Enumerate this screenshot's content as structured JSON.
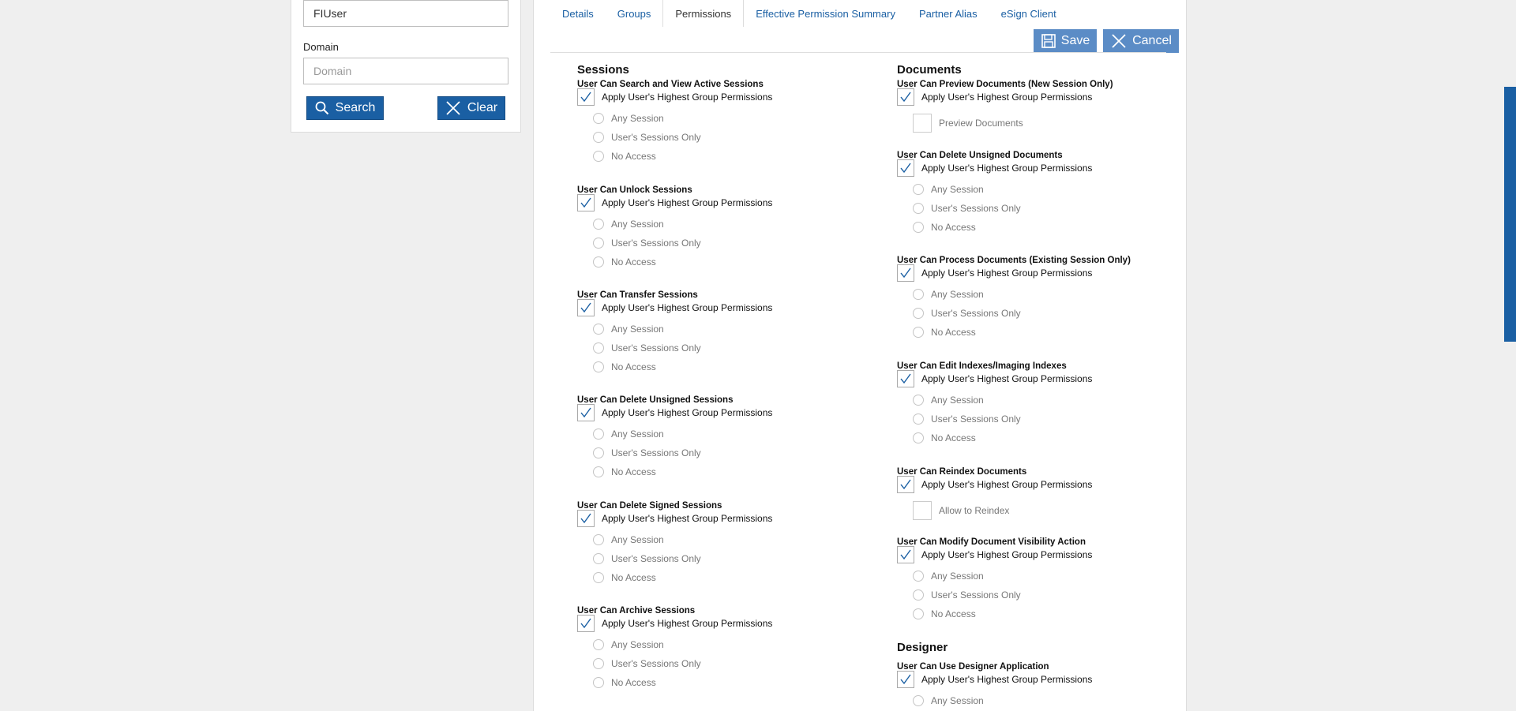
{
  "search_panel": {
    "username_value": "FIUser",
    "domain_label": "Domain",
    "domain_placeholder": "Domain",
    "search_label": "Search",
    "clear_label": "Clear"
  },
  "tabs": [
    {
      "label": "Details"
    },
    {
      "label": "Groups"
    },
    {
      "label": "Permissions"
    },
    {
      "label": "Effective Permission Summary"
    },
    {
      "label": "Partner Alias"
    },
    {
      "label": "eSign Client"
    }
  ],
  "active_tab": "Permissions",
  "actions": {
    "save_label": "Save",
    "cancel_label": "Cancel"
  },
  "colors": {
    "accent": "#1a5fa3",
    "action_button": "#5b8cc6"
  },
  "apply_label": "Apply User's Highest Group Permissions",
  "radio_options": {
    "any": "Any Session",
    "users": "User's Sessions Only",
    "none": "No Access"
  },
  "sessions": {
    "title": "Sessions",
    "perms": [
      {
        "title": "User Can Search and View Active Sessions"
      },
      {
        "title": "User Can Unlock Sessions"
      },
      {
        "title": "User Can Transfer Sessions"
      },
      {
        "title": "User Can Delete Unsigned Sessions"
      },
      {
        "title": "User Can Delete Signed Sessions"
      },
      {
        "title": "User Can Archive Sessions"
      }
    ]
  },
  "documents": {
    "title": "Documents",
    "perms": [
      {
        "title": "User Can Preview Documents (New Session Only)",
        "sub_label": "Preview Documents"
      },
      {
        "title": "User Can Delete Unsigned Documents"
      },
      {
        "title": "User Can Process Documents (Existing Session Only)"
      },
      {
        "title": "User Can Edit Indexes/Imaging Indexes"
      },
      {
        "title": "User Can Reindex Documents",
        "sub_label": "Allow to Reindex"
      },
      {
        "title": "User Can Modify Document Visibility Action"
      }
    ]
  },
  "designer": {
    "title": "Designer",
    "perms": [
      {
        "title": "User Can Use Designer Application"
      }
    ]
  }
}
